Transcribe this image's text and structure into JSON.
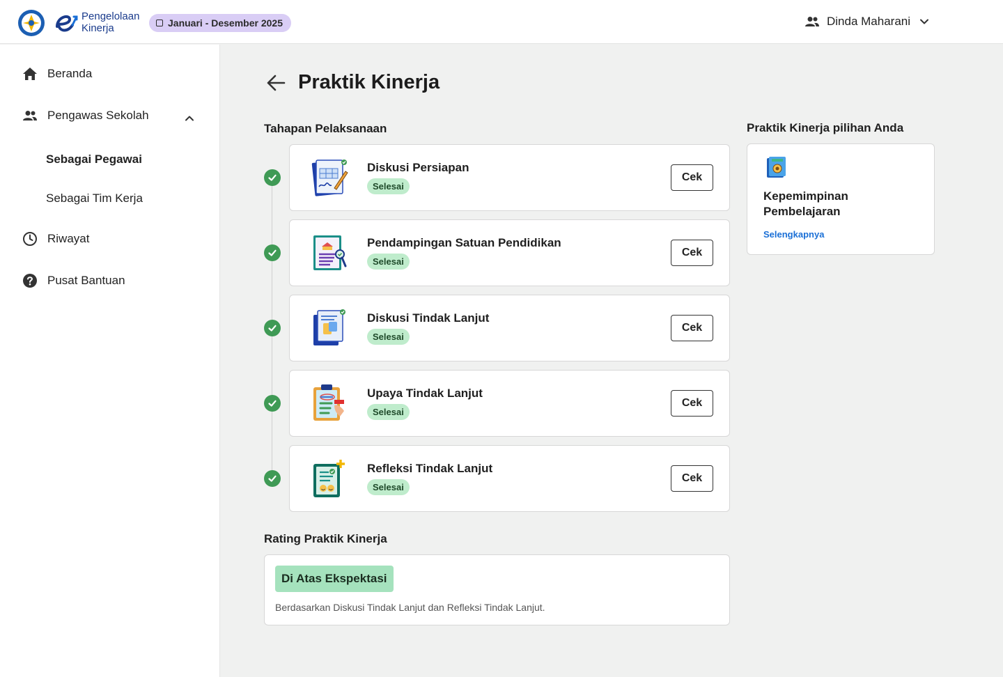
{
  "header": {
    "app_name_line1": "Pengelolaan",
    "app_name_line2": "Kinerja",
    "period": "Januari - Desember 2025",
    "user_name": "Dinda Maharani"
  },
  "sidebar": {
    "items": [
      {
        "label": "Beranda",
        "icon": "home-icon"
      },
      {
        "label": "Pengawas Sekolah",
        "icon": "people-icon"
      },
      {
        "label": "Riwayat",
        "icon": "clock-icon"
      },
      {
        "label": "Pusat Bantuan",
        "icon": "help-icon"
      }
    ],
    "sub_items": [
      {
        "label": "Sebagai Pegawai",
        "active": true
      },
      {
        "label": "Sebagai Tim Kerja",
        "active": false
      }
    ]
  },
  "page": {
    "title": "Praktik Kinerja",
    "stages_title": "Tahapan Pelaksanaan",
    "stages": [
      {
        "name": "Diskusi Persiapan",
        "status": "Selesai",
        "action": "Cek"
      },
      {
        "name": "Pendampingan Satuan Pendidikan",
        "status": "Selesai",
        "action": "Cek"
      },
      {
        "name": "Diskusi Tindak Lanjut",
        "status": "Selesai",
        "action": "Cek"
      },
      {
        "name": "Upaya Tindak Lanjut",
        "status": "Selesai",
        "action": "Cek"
      },
      {
        "name": "Refleksi Tindak Lanjut",
        "status": "Selesai",
        "action": "Cek"
      }
    ],
    "pilihan_title": "Praktik Kinerja pilihan Anda",
    "pilihan_name": "Kepemimpinan Pembelajaran",
    "pilihan_link": "Selengkapnya",
    "rating_title": "Rating Praktik Kinerja",
    "rating_value": "Di Atas Ekspektasi",
    "rating_desc": "Berdasarkan Diskusi Tindak Lanjut dan Refleksi Tindak Lanjut."
  },
  "colors": {
    "accent_check": "#3f9a55",
    "status_badge_bg": "#bfeccc",
    "rating_badge_bg": "#a5e2bd",
    "period_badge_bg": "#d9cdf5",
    "link": "#1a6fd6"
  }
}
